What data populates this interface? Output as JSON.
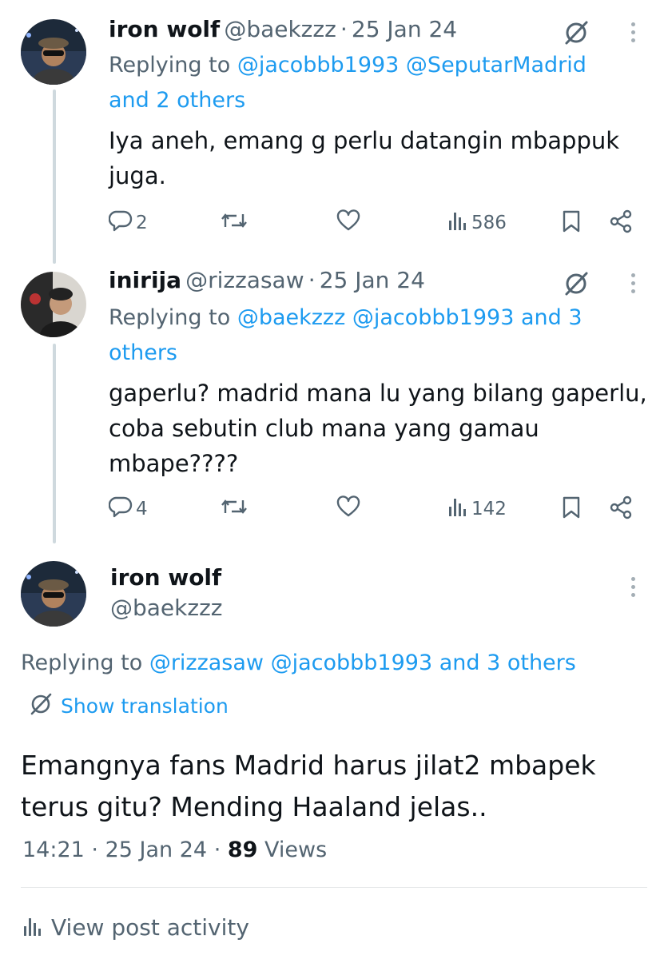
{
  "tweets": [
    {
      "name": "iron wolf",
      "handle": "@baekzzz",
      "sep": "·",
      "date": "25 Jan 24",
      "replying_prefix": "Replying to",
      "replying_line1": "@jacobbb1993 @SeputarMadrid",
      "replying_line2": "and 2 others",
      "text_line1": "Iya aneh, emang g perlu datangin mbappuk",
      "text_line2": "juga.",
      "replies": "2",
      "views": "586"
    },
    {
      "name": "inirija",
      "handle": "@rizzasaw",
      "sep": "·",
      "date": "25 Jan 24",
      "replying_prefix": "Replying to",
      "replying_line1": "@baekzzz @jacobbb1993 and 3",
      "replying_line2": "others",
      "text_line1": "gaperlu? madrid mana lu yang bilang gaperlu,",
      "text_line2": "coba sebutin club mana yang gamau",
      "text_line3": "mbape????",
      "replies": "4",
      "views": "142"
    }
  ],
  "main": {
    "name": "iron wolf",
    "handle": "@baekzzz",
    "replying_prefix": "Replying to",
    "replying_to": "@rizzasaw @jacobbb1993 and 3 others",
    "show_translation": "Show translation",
    "text_line1": "Emangnya fans Madrid harus jilat2 mbapek",
    "text_line2": "terus gitu? Mending Haaland jelas..",
    "time": "14:21",
    "sep1": "·",
    "date": "25 Jan 24",
    "sep2": "·",
    "views_count": "89",
    "views_label": "Views",
    "view_activity": "View post activity"
  },
  "colors": {
    "accent": "#1d9bf0",
    "muted": "#536471",
    "text": "#0f1419",
    "line": "#cfd9de"
  },
  "icons": [
    "grok-icon",
    "more-icon",
    "reply-icon",
    "retweet-icon",
    "like-icon",
    "views-icon",
    "bookmark-icon",
    "share-icon",
    "translate-icon",
    "analytics-icon"
  ]
}
